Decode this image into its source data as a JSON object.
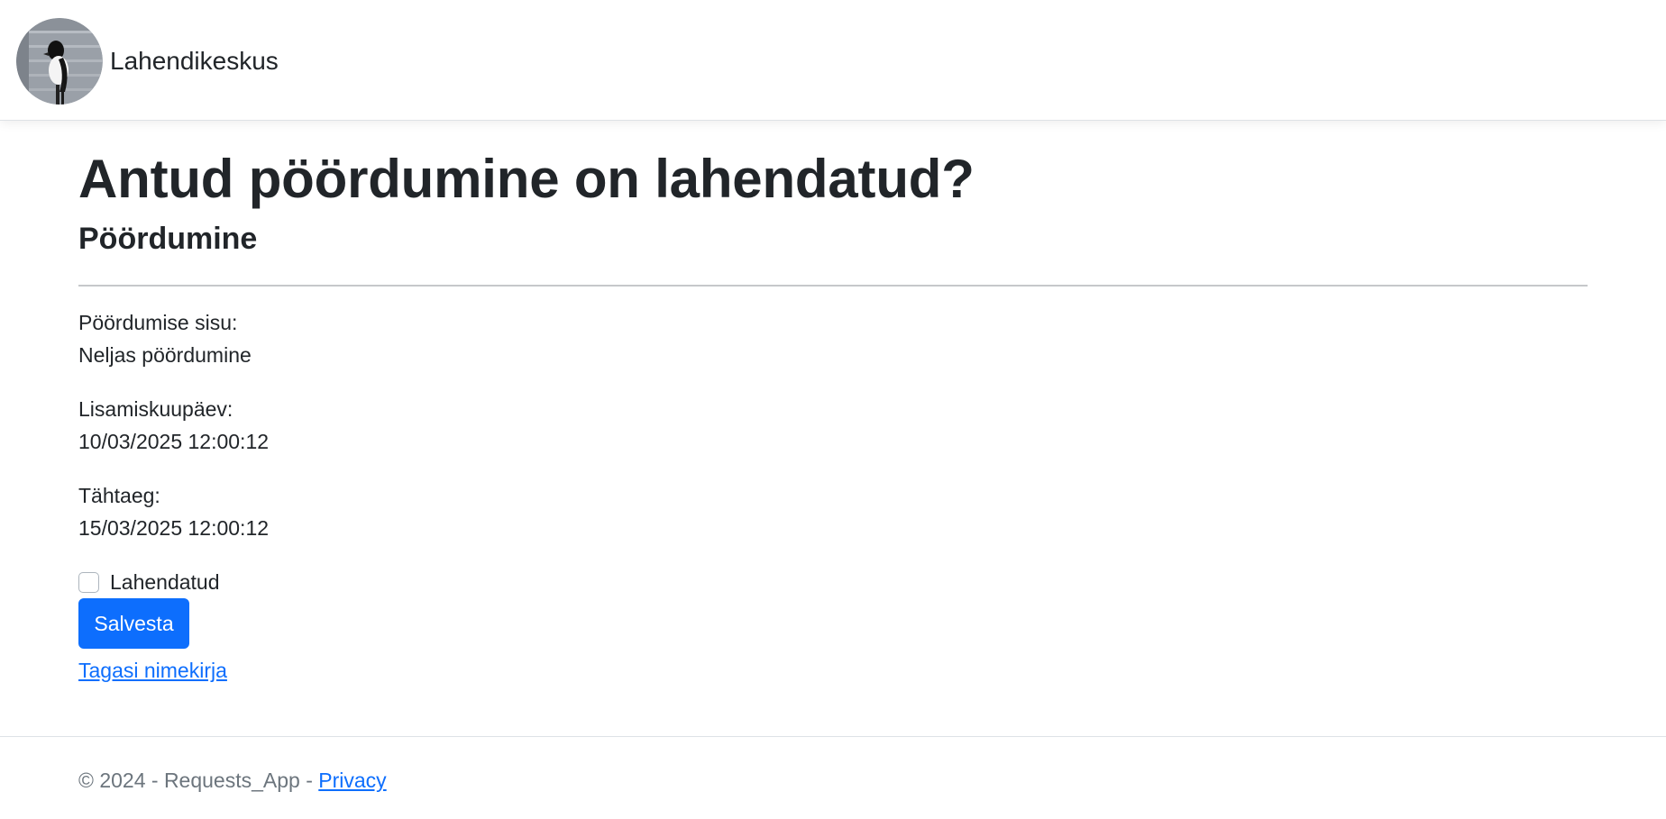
{
  "navbar": {
    "brand": "Lahendikeskus",
    "logo": "magpie-bird-avatar"
  },
  "main": {
    "title": "Antud pöördumine on lahendatud?",
    "subtitle": "Pöördumine",
    "fields": [
      {
        "label": "Pöördumise sisu:",
        "value": "Neljas pöördumine"
      },
      {
        "label": "Lisamiskuupäev:",
        "value": "10/03/2025 12:00:12"
      },
      {
        "label": "Tähtaeg:",
        "value": "15/03/2025 12:00:12"
      }
    ],
    "checkbox": {
      "label": "Lahendatud",
      "checked": false
    },
    "save_label": "Salvesta",
    "back_link": "Tagasi nimekirja"
  },
  "footer": {
    "text": "© 2024 - Requests_App - ",
    "privacy_link": "Privacy"
  },
  "colors": {
    "primary": "#0d6efd",
    "text": "#212529",
    "muted": "#6c757d"
  }
}
